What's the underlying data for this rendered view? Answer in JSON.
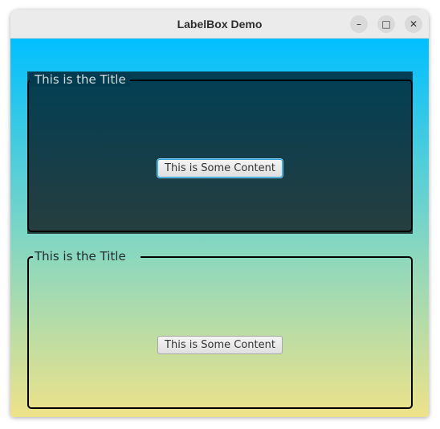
{
  "window": {
    "title": "LabelBox Demo",
    "controls": {
      "minimize": "–",
      "maximize": "□",
      "close": "✕"
    }
  },
  "boxes": [
    {
      "title": "This is the Title",
      "content_button": "This is Some Content"
    },
    {
      "title": "This is the Title",
      "content_button": "This is Some Content"
    }
  ],
  "colors": {
    "gradient_top": "#00bfff",
    "gradient_bottom": "#eee289",
    "dark_box_top": "#003b50",
    "dark_box_bottom": "#24393a",
    "focus_ring": "#2a9fd6"
  }
}
